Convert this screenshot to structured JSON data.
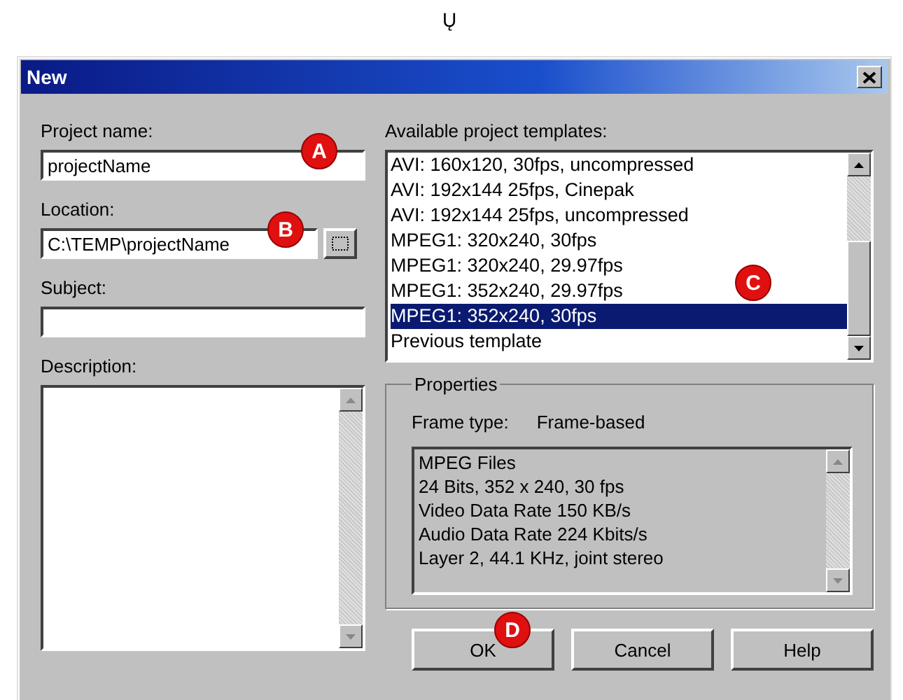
{
  "top_glyph": "Ų",
  "window": {
    "title": "New"
  },
  "fields": [
    {
      "label": "Project name:",
      "value": "projectName",
      "browse": false
    },
    {
      "label": "Location:",
      "value": "C:\\TEMP\\projectName",
      "browse": true
    },
    {
      "label": "Subject:",
      "browse": false
    }
  ],
  "description": {
    "label": "Description:"
  },
  "templates": {
    "label": "Available project templates:",
    "items": [
      {
        "text": "AVI: 160x120, 30fps, uncompressed",
        "selected": false
      },
      {
        "text": "AVI: 192x144 25fps, Cinepak",
        "selected": false
      },
      {
        "text": "AVI: 192x144 25fps, uncompressed",
        "selected": false
      },
      {
        "text": "MPEG1: 320x240, 30fps",
        "selected": false
      },
      {
        "text": "MPEG1: 320x240, 29.97fps",
        "selected": false
      },
      {
        "text": "MPEG1: 352x240, 29.97fps",
        "selected": false
      },
      {
        "text": "MPEG1: 352x240, 30fps",
        "selected": true
      },
      {
        "text": "Previous template",
        "selected": false
      }
    ]
  },
  "properties": {
    "title": "Properties",
    "frame_type_label": "Frame type:",
    "frame_type": "Frame-based",
    "lines": [
      "MPEG Files",
      "24 Bits, 352 x 240, 30 fps",
      "Video Data Rate 150 KB/s",
      "Audio Data Rate 224 Kbits/s",
      "Layer 2, 44.1 KHz, joint stereo"
    ]
  },
  "buttons": [
    "OK",
    "Cancel",
    "Help"
  ],
  "markers": [
    "A",
    "B",
    "C",
    "D"
  ]
}
